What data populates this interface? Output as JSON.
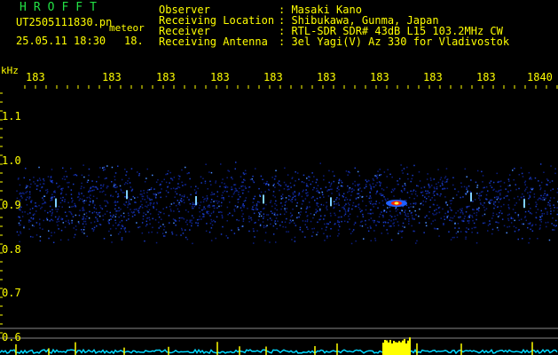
{
  "header": {
    "app_title": "HROFFT",
    "file_name": "UT2505111830.pn",
    "mode": "meteor",
    "date_time": "25.05.11 18:30",
    "minute": "18."
  },
  "info": [
    {
      "label": "Observer",
      "value": ": Masaki Kano"
    },
    {
      "label": "Receiving Location",
      "value": ": Shibukawa, Gunma, Japan"
    },
    {
      "label": "Receiver",
      "value": ": RTL-SDR SDR# 43dB L15 103.2MHz CW"
    },
    {
      "label": "Receiving Antenna",
      "value": ": 3el Yagi(V) Az 330 for Vladivostok"
    }
  ],
  "axes": {
    "unit_label": "kHz",
    "x_ticks": [
      "183",
      "183",
      "183",
      "183",
      "183",
      "183",
      "183",
      "183",
      "183",
      "1840"
    ],
    "y_ticks": [
      "1.1",
      "1.0",
      "0.9",
      "0.8",
      "0.7",
      "0.6"
    ]
  },
  "colors": {
    "text": "#ffff00",
    "title": "#22e044",
    "background": "#000000",
    "signal_low": "#1030a0",
    "signal_high": "#ff2200",
    "baseline": "#00d8ff"
  }
}
